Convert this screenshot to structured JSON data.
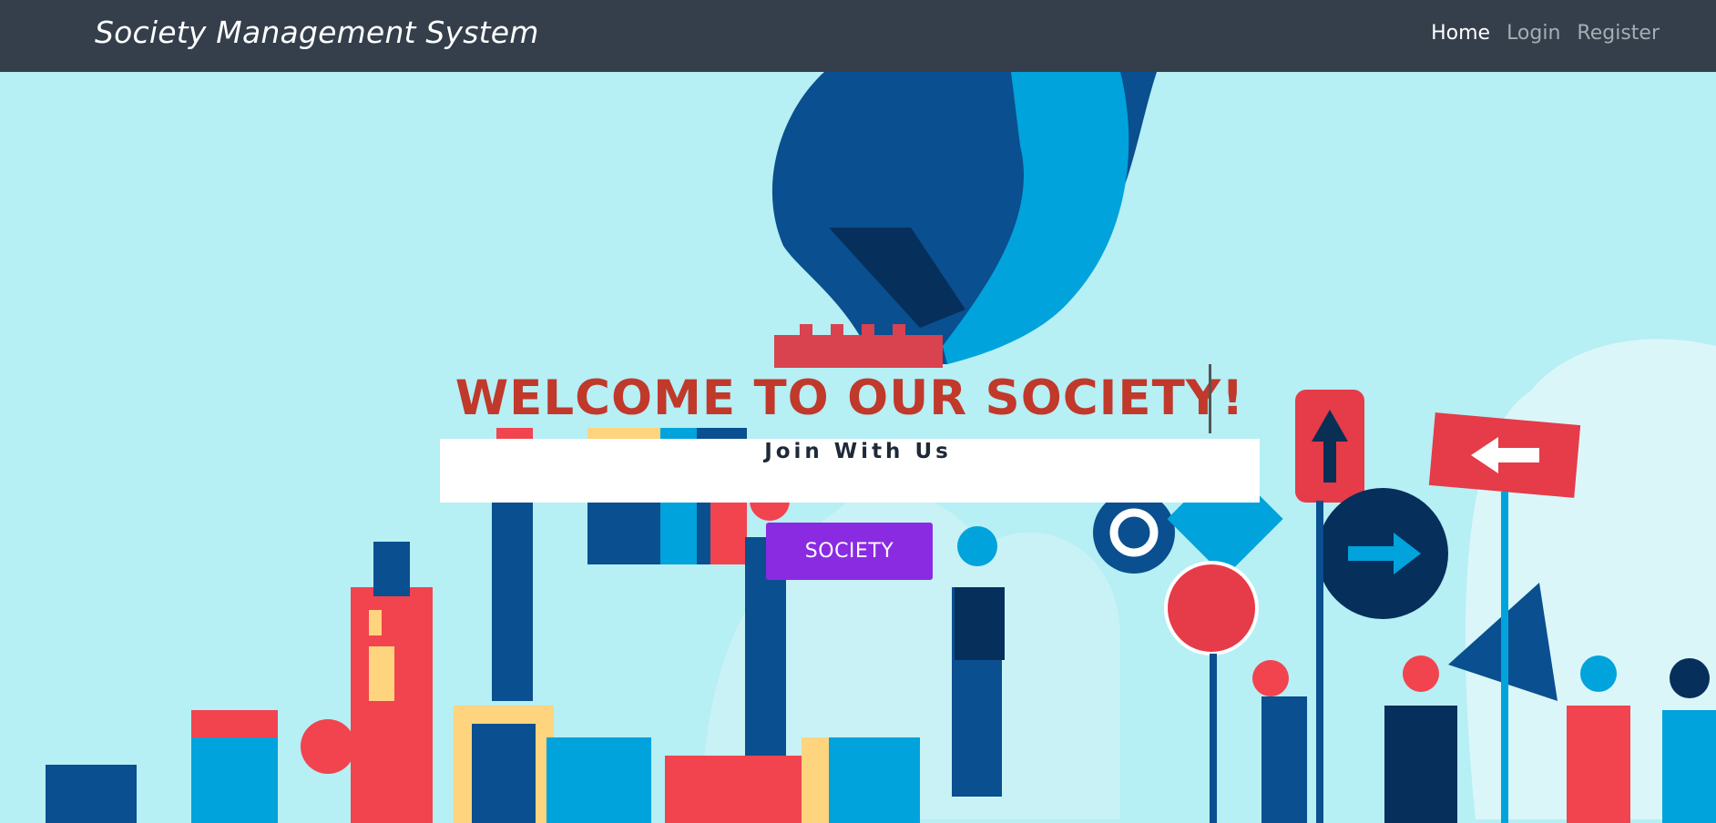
{
  "navbar": {
    "brand": "Society Management System",
    "links": [
      {
        "label": "Home",
        "active": true
      },
      {
        "label": "Login",
        "active": false
      },
      {
        "label": "Register",
        "active": false
      }
    ]
  },
  "hero": {
    "heading": "WELCOME TO OUR SOCIETY!",
    "subheading": "Join With Us",
    "button_label": "SOCIETY"
  },
  "colors": {
    "navbar_bg": "#343f4b",
    "hero_bg": "#b6eff4",
    "heading": "#c0392b",
    "button": "#8a2be2"
  }
}
